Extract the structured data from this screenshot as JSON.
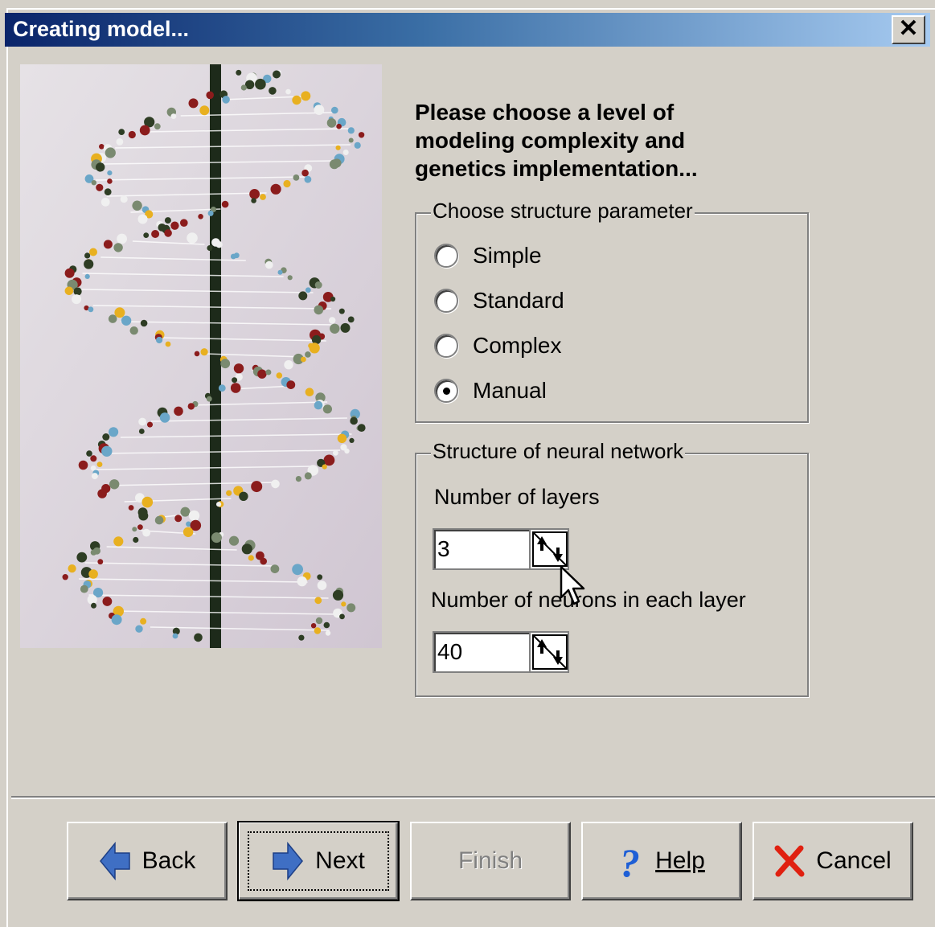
{
  "dialog": {
    "title": "Creating model...",
    "close_label": "✕"
  },
  "heading": {
    "line1": "Please choose a level of",
    "line2": "modeling complexity and",
    "line3": "genetics implementation..."
  },
  "structure_group": {
    "legend": "Choose structure parameter",
    "options": [
      {
        "label": "Simple",
        "checked": false
      },
      {
        "label": "Standard",
        "checked": false
      },
      {
        "label": "Complex",
        "checked": false
      },
      {
        "label": "Manual",
        "checked": true
      }
    ]
  },
  "network_group": {
    "legend": "Structure of neural network",
    "layers_label": "Number of layers",
    "layers_value": "3",
    "neurons_label": "Number of neurons in each layer",
    "neurons_value": "40"
  },
  "buttons": {
    "back": "Back",
    "next": "Next",
    "finish": "Finish",
    "help": "Help",
    "cancel": "Cancel"
  },
  "icons": {
    "back": "arrow-left-icon",
    "next": "arrow-right-icon",
    "help": "question-mark-icon",
    "cancel": "red-x-icon",
    "spin": "up-down-arrows-icon",
    "picture": "dna-helix-model-image"
  },
  "colors": {
    "window": "#d4d0c8",
    "title_start": "#0a246a",
    "title_end": "#a6caf0",
    "arrow_blue": "#3f6fc4",
    "help_blue": "#1e5fd6",
    "cancel_red": "#e02010"
  }
}
